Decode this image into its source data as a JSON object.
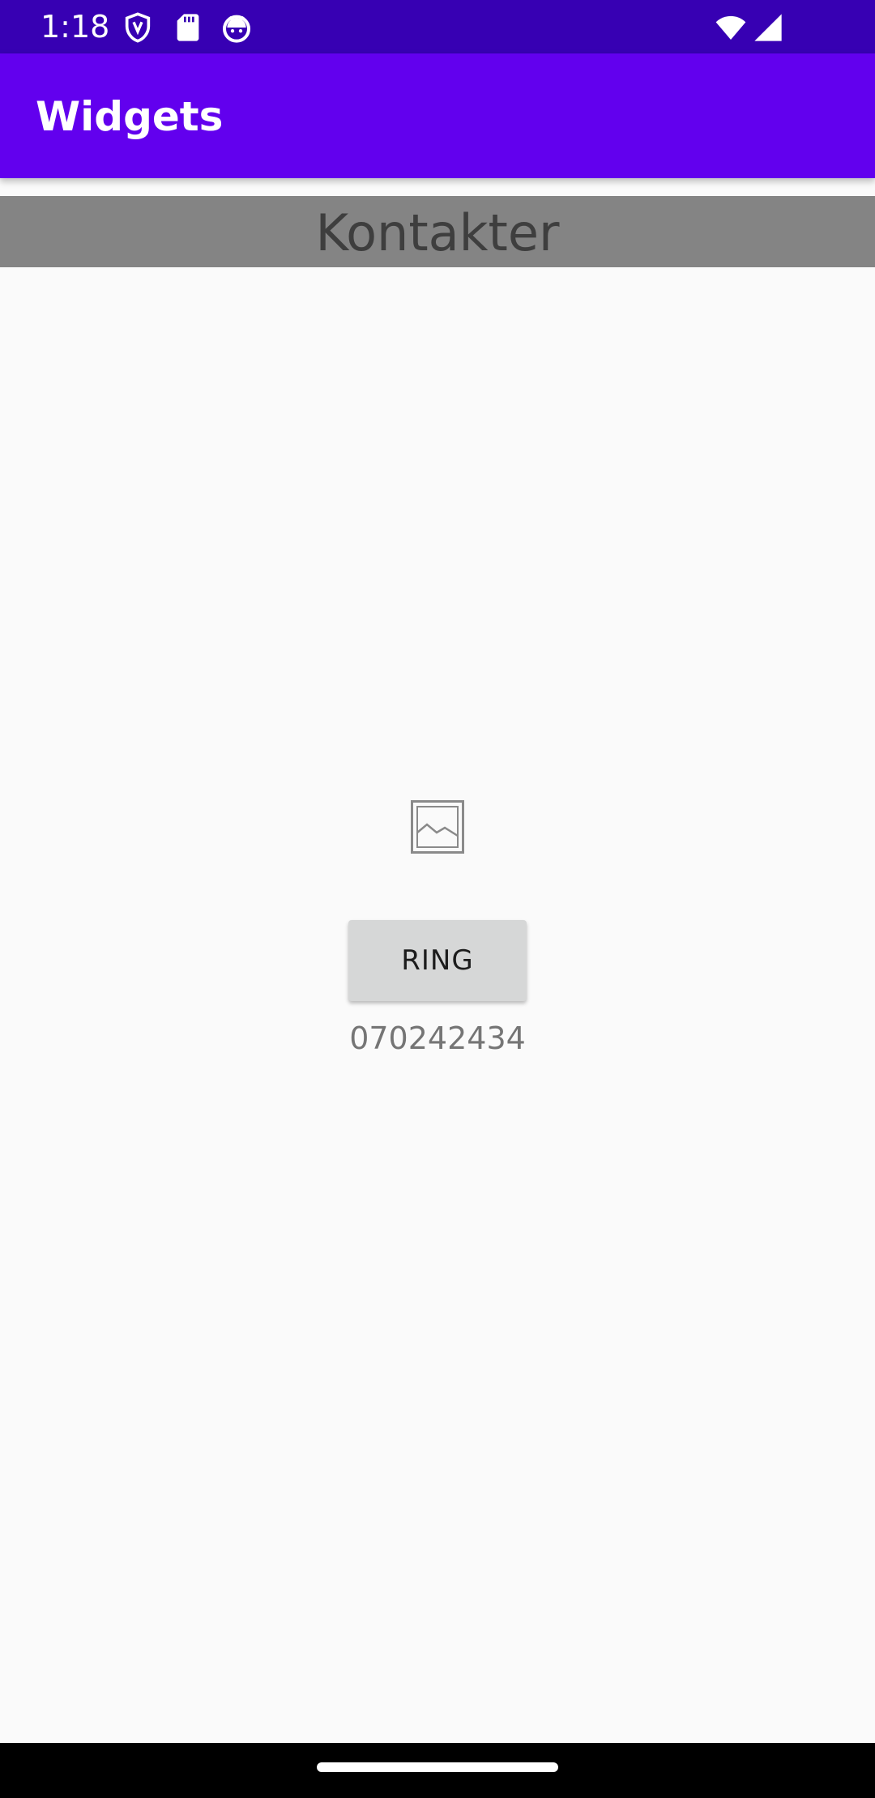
{
  "status_bar": {
    "time": "1:18",
    "icons": [
      "shield-icon",
      "sd-card-icon",
      "android-debug-icon",
      "wifi-icon",
      "cellular-signal-icon"
    ]
  },
  "app_bar": {
    "title": "Widgets"
  },
  "header": {
    "title": "Kontakter"
  },
  "contact": {
    "image_icon": "image-placeholder-icon",
    "call_button_label": "RING",
    "phone_number": "070242434"
  },
  "colors": {
    "status_bar": "#3700b3",
    "app_bar": "#6200ee",
    "header_band": "#848484",
    "button": "#d6d7d7",
    "background": "#fafafa"
  }
}
